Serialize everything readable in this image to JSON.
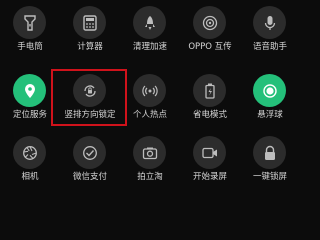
{
  "tiles": [
    {
      "label": "手电筒",
      "icon": "flashlight-icon",
      "active": false
    },
    {
      "label": "计算器",
      "icon": "calculator-icon",
      "active": false
    },
    {
      "label": "清理加速",
      "icon": "rocket-icon",
      "active": false
    },
    {
      "label": "OPPO 互传",
      "icon": "share-icon",
      "active": false
    },
    {
      "label": "语音助手",
      "icon": "microphone-icon",
      "active": false
    },
    {
      "label": "定位服务",
      "icon": "location-pin-icon",
      "active": true
    },
    {
      "label": "竖排方向锁定",
      "icon": "rotation-lock-icon",
      "active": false
    },
    {
      "label": "个人热点",
      "icon": "hotspot-icon",
      "active": false
    },
    {
      "label": "省电模式",
      "icon": "battery-saver-icon",
      "active": false
    },
    {
      "label": "悬浮球",
      "icon": "floating-ball-icon",
      "active": true
    },
    {
      "label": "相机",
      "icon": "camera-aperture-icon",
      "active": false
    },
    {
      "label": "微信支付",
      "icon": "wechat-pay-icon",
      "active": false
    },
    {
      "label": "拍立淘",
      "icon": "photo-search-icon",
      "active": false
    },
    {
      "label": "开始录屏",
      "icon": "screen-record-icon",
      "active": false
    },
    {
      "label": "一键锁屏",
      "icon": "lock-icon",
      "active": false
    }
  ],
  "colors": {
    "background": "#0c0c0c",
    "tile": "#2c2c2c",
    "active": "#24c07a",
    "highlight": "#d0121b"
  }
}
